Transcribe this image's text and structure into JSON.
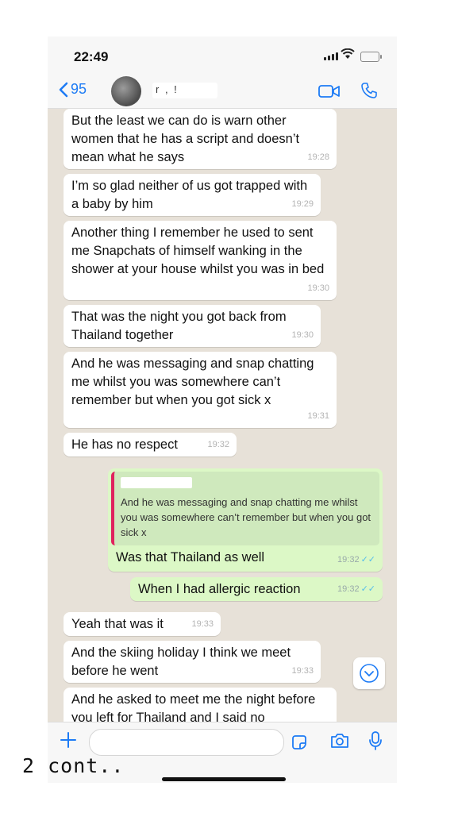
{
  "status_bar": {
    "time": "22:49"
  },
  "header": {
    "back_count": "95",
    "contact_name": "r      ,     !"
  },
  "messages": [
    {
      "dir": "in",
      "text": "But the least we can do is warn other women that he has a script and doesn’t mean what he says",
      "time": "19:28"
    },
    {
      "dir": "in",
      "text": "I’m so glad neither of us got trapped with a baby by him",
      "time": "19:29"
    },
    {
      "dir": "in",
      "text": "Another thing I remember he used to sent me Snapchats of himself wanking in the shower at your house whilst you was in bed",
      "time": "19:30"
    },
    {
      "dir": "in",
      "text": "That was the night you got back from Thailand together",
      "time": "19:30"
    },
    {
      "dir": "in",
      "text": "And he was messaging and snap chatting me whilst you was somewhere can’t remember but when you got sick x",
      "time": "19:31"
    },
    {
      "dir": "in",
      "text": "He has no respect",
      "time": "19:32"
    },
    {
      "dir": "out",
      "quote": "And he was messaging and snap chatting me whilst you was somewhere can’t remember but when you got sick x",
      "text": "Was that Thailand as well",
      "time": "19:32"
    },
    {
      "dir": "out",
      "text": "When I had allergic reaction",
      "time": "19:32"
    },
    {
      "dir": "in",
      "text": "Yeah that was it",
      "time": "19:33"
    },
    {
      "dir": "in",
      "text": "And the skiing holiday I think we meet before he went",
      "time": "19:33"
    },
    {
      "dir": "in",
      "text": "And he asked to meet me the night before you left for Thailand and I said no",
      "time": ""
    }
  ],
  "input": {
    "placeholder": ""
  },
  "caption": "2 cont..",
  "colors": {
    "accent": "#1d7bf5",
    "outgoing_bubble": "#dcf8c6",
    "incoming_bubble": "#ffffff",
    "chat_bg": "#e7e1d8",
    "read_ticks": "#53bdeb",
    "quote_bar": "#e0245e"
  }
}
